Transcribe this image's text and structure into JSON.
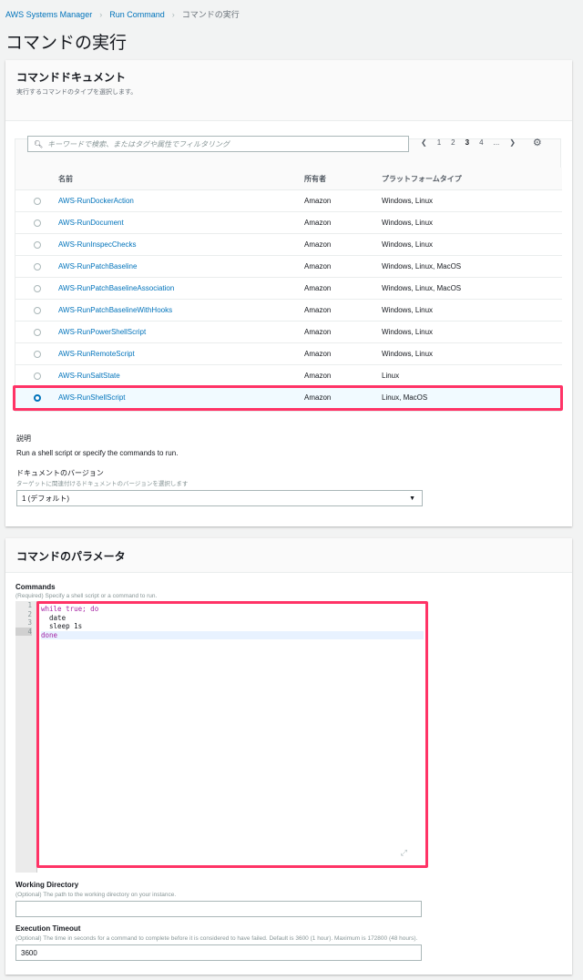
{
  "breadcrumb": [
    "AWS Systems Manager",
    "Run Command",
    "コマンドの実行"
  ],
  "page_title": "コマンドの実行",
  "doc_panel": {
    "title": "コマンドドキュメント",
    "subtitle": "実行するコマンドのタイプを選択します。",
    "search_placeholder": "キーワードで検索、またはタグや属性でフィルタリング",
    "pages": [
      "1",
      "2",
      "3",
      "4",
      "..."
    ],
    "current_page": "3",
    "columns": [
      "名前",
      "所有者",
      "プラットフォームタイプ"
    ],
    "rows": [
      {
        "name": "AWS-RunDockerAction",
        "owner": "Amazon",
        "platform": "Windows, Linux"
      },
      {
        "name": "AWS-RunDocument",
        "owner": "Amazon",
        "platform": "Windows, Linux"
      },
      {
        "name": "AWS-RunInspecChecks",
        "owner": "Amazon",
        "platform": "Windows, Linux"
      },
      {
        "name": "AWS-RunPatchBaseline",
        "owner": "Amazon",
        "platform": "Windows, Linux, MacOS"
      },
      {
        "name": "AWS-RunPatchBaselineAssociation",
        "owner": "Amazon",
        "platform": "Windows, Linux, MacOS"
      },
      {
        "name": "AWS-RunPatchBaselineWithHooks",
        "owner": "Amazon",
        "platform": "Windows, Linux"
      },
      {
        "name": "AWS-RunPowerShellScript",
        "owner": "Amazon",
        "platform": "Windows, Linux"
      },
      {
        "name": "AWS-RunRemoteScript",
        "owner": "Amazon",
        "platform": "Windows, Linux"
      },
      {
        "name": "AWS-RunSaltState",
        "owner": "Amazon",
        "platform": "Linux"
      },
      {
        "name": "AWS-RunShellScript",
        "owner": "Amazon",
        "platform": "Linux, MacOS"
      }
    ],
    "selected_index": 9,
    "description_label": "説明",
    "description": "Run a shell script or specify the commands to run.",
    "version_label": "ドキュメントのバージョン",
    "version_hint": "ターゲットに関連付けるドキュメントのバージョンを選択します",
    "version_value": "1 (デフォルト)"
  },
  "params_panel": {
    "title": "コマンドのパラメータ",
    "commands_label": "Commands",
    "commands_hint": "(Required) Specify a shell script or a command to run.",
    "code_lines": [
      "while true; do",
      "  date",
      "  sleep 1s",
      "done"
    ],
    "line_numbers": [
      "1",
      "2",
      "3",
      "4"
    ],
    "workdir_label": "Working Directory",
    "workdir_hint": "(Optional) The path to the working directory on your instance.",
    "workdir_value": "",
    "timeout_label": "Execution Timeout",
    "timeout_hint": "(Optional) The time in seconds for a command to complete before it is considered to have failed. Default is 3600 (1 hour). Maximum is 172800 (48 hours).",
    "timeout_value": "3600"
  },
  "colors": {
    "highlight": "#ff3366",
    "link": "#0073bb"
  }
}
